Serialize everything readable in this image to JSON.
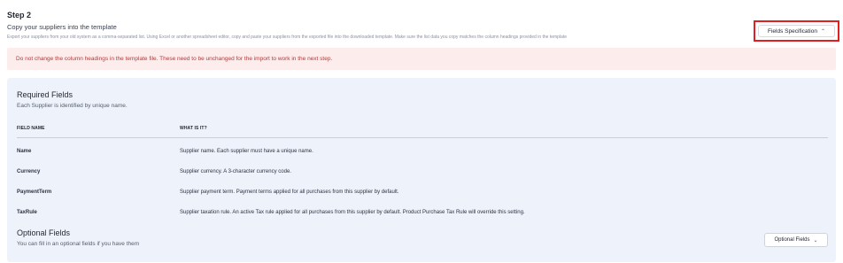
{
  "step": {
    "title": "Step 2",
    "subtitle": "Copy your suppliers into the template",
    "description": "Export your suppliers from your old system as a comma-separated list. Using Excel or another spreadsheet editor, copy and paste your suppliers from the exported file into the downloaded template. Make sure the list data you copy matches the column headings provided in the template"
  },
  "fields_spec_button": {
    "label": "Fields Specification",
    "icon": "chevron-up-icon",
    "highlight_color": "#e02020"
  },
  "alert": {
    "text": "Do not change the column headings in the template file. These need to be unchanged for the import to work in the next step.",
    "bg": "#fdecec",
    "color": "#b33a3a"
  },
  "required": {
    "title": "Required Fields",
    "subtitle": "Each Supplier is identified by unique name.",
    "headers": {
      "field_name": "FIELD NAME",
      "what": "WHAT IS IT?"
    },
    "rows": [
      {
        "field": "Name",
        "desc": "Supplier name. Each supplier must have a unique name."
      },
      {
        "field": "Currency",
        "desc": "Supplier currency. A 3-character currency code."
      },
      {
        "field": "PaymentTerm",
        "desc": "Supplier payment term. Payment terms applied for all purchases from this supplier by default."
      },
      {
        "field": "TaxRule",
        "desc": "Supplier taxation rule. An active Tax rule applied for all purchases from this supplier by default. Product Purchase Tax Rule will override this setting."
      }
    ]
  },
  "optional": {
    "title": "Optional Fields",
    "subtitle": "You can fill in an optional fields if you have them",
    "button_label": "Optional Fields",
    "button_icon": "chevron-down-icon"
  },
  "colors": {
    "panel_bg": "#eef3fb"
  }
}
